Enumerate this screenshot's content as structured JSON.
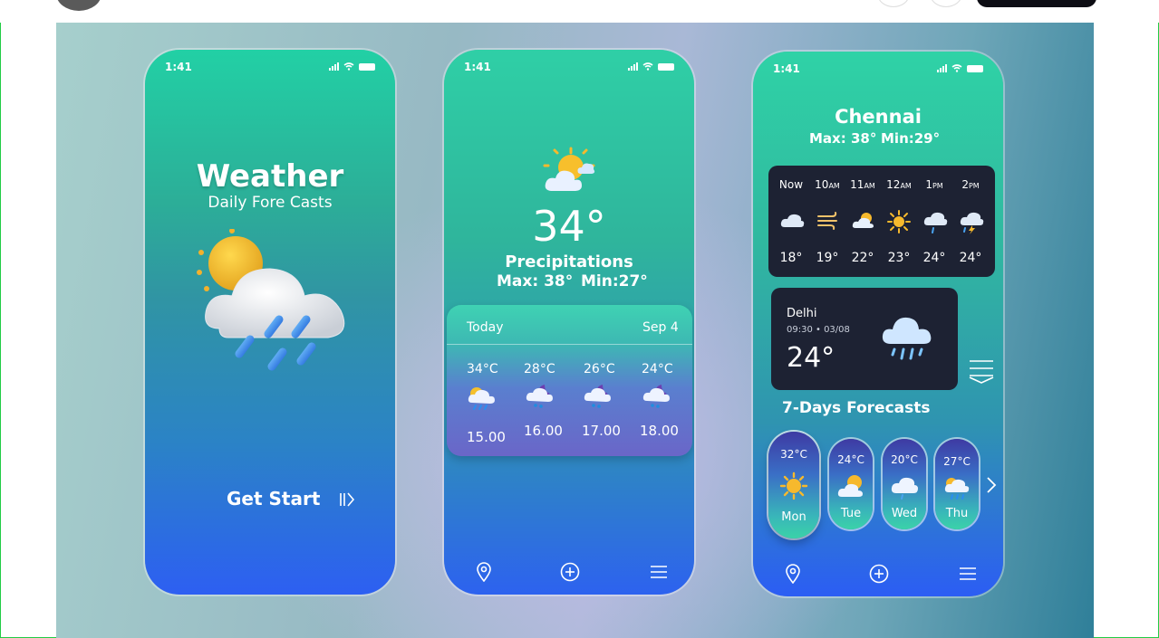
{
  "screen1": {
    "time": "1:41",
    "title": "Weather",
    "subtitle": "Daily Fore Casts",
    "cta_label": "Get Start"
  },
  "screen2": {
    "time": "1:41",
    "temperature": "34°",
    "condition": "Precipitations",
    "max": "Max: 38°",
    "min": "Min:27°",
    "card": {
      "today_label": "Today",
      "date": "Sep 4",
      "items": [
        {
          "temp": "34°C",
          "value": "15.00",
          "icon": "cloud-rain-sun-icon"
        },
        {
          "temp": "28°C",
          "value": "16.00",
          "icon": "cloud-rain-moon-icon"
        },
        {
          "temp": "26°C",
          "value": "17.00",
          "icon": "cloud-rain-moon-icon"
        },
        {
          "temp": "24°C",
          "value": "18.00",
          "icon": "cloud-rain-moon-icon"
        }
      ]
    }
  },
  "screen3": {
    "time": "1:41",
    "city": "Chennai",
    "max": "Max: 38°",
    "min": "Min:29°",
    "hourly": [
      {
        "time": "Now",
        "suffix": "",
        "temp": "18°",
        "icon": "cloud-icon"
      },
      {
        "time": "10",
        "suffix": "AM",
        "temp": "19°",
        "icon": "wind-icon"
      },
      {
        "time": "11",
        "suffix": "AM",
        "temp": "22°",
        "icon": "sun-cloud-icon"
      },
      {
        "time": "12",
        "suffix": "AM",
        "temp": "23°",
        "icon": "sun-icon"
      },
      {
        "time": "1",
        "suffix": "PM",
        "temp": "24°",
        "icon": "rain-cloud-icon"
      },
      {
        "time": "2",
        "suffix": "PM",
        "temp": "24°",
        "icon": "storm-cloud-icon"
      }
    ],
    "delhi": {
      "city": "Delhi",
      "datetime": "09:30 • 03/08",
      "temp": "24°"
    },
    "forecast_title": "7-Days Forecasts",
    "days": [
      {
        "temp": "32°C",
        "day": "Mon",
        "icon": "sun-icon"
      },
      {
        "temp": "24°C",
        "day": "Tue",
        "icon": "sun-cloud-icon"
      },
      {
        "temp": "20°C",
        "day": "Wed",
        "icon": "cloud-icon"
      },
      {
        "temp": "27°C",
        "day": "Thu",
        "icon": "cloud-rain-icon"
      }
    ]
  },
  "colors": {
    "accent_green": "#2fd2a6",
    "accent_blue": "#2d5ff2",
    "dark_card": "#1d2233",
    "sun": "#f4b82a"
  }
}
